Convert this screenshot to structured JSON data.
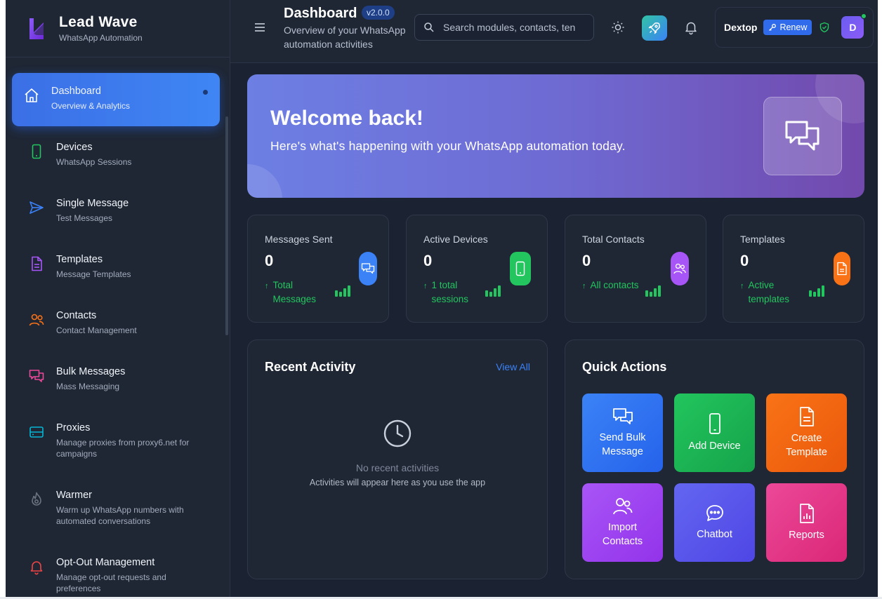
{
  "app": {
    "name": "Lead Wave",
    "subtitle": "WhatsApp Automation"
  },
  "sidebar": {
    "items": [
      {
        "label": "Dashboard",
        "sub": "Overview & Analytics",
        "icon": "home-icon",
        "active": true
      },
      {
        "label": "Devices",
        "sub": "WhatsApp Sessions",
        "icon": "phone-icon",
        "color": "#22c55e"
      },
      {
        "label": "Single Message",
        "sub": "Test Messages",
        "icon": "send-icon",
        "color": "#3b82f6"
      },
      {
        "label": "Templates",
        "sub": "Message Templates",
        "icon": "document-icon",
        "color": "#a855f7"
      },
      {
        "label": "Contacts",
        "sub": "Contact Management",
        "icon": "users-icon",
        "color": "#f97316"
      },
      {
        "label": "Bulk Messages",
        "sub": "Mass Messaging",
        "icon": "chat-bubbles-icon",
        "color": "#ec4899"
      },
      {
        "label": "Proxies",
        "sub": "Manage proxies from proxy6.net for campaigns",
        "icon": "server-icon",
        "color": "#06b6d4"
      },
      {
        "label": "Warmer",
        "sub": "Warm up WhatsApp numbers with automated conversations",
        "icon": "flame-icon",
        "color": "#6b7280"
      },
      {
        "label": "Opt-Out Management",
        "sub": "Manage opt-out requests and preferences",
        "icon": "bell-icon",
        "color": "#ef4444"
      }
    ]
  },
  "header": {
    "title": "Dashboard",
    "version": "v2.0.0",
    "subtitle": "Overview of your WhatsApp automation activities",
    "search_placeholder": "Search modules, contacts, ten",
    "user_name": "Dextop",
    "renew_label": "Renew",
    "avatar_initial": "D"
  },
  "hero": {
    "title": "Welcome back!",
    "subtitle": "Here's what's happening with your WhatsApp automation today."
  },
  "stats": [
    {
      "title": "Messages Sent",
      "value": "0",
      "note": "Total Messages",
      "icon": "chat-bubbles-icon",
      "color": "#3b82f6"
    },
    {
      "title": "Active Devices",
      "value": "0",
      "note": "1 total sessions",
      "icon": "phone-icon",
      "color": "#22c55e"
    },
    {
      "title": "Total Contacts",
      "value": "0",
      "note": "All contacts",
      "icon": "users-icon",
      "color": "#a855f7"
    },
    {
      "title": "Templates",
      "value": "0",
      "note": "Active templates",
      "icon": "document-icon",
      "color": "#f97316"
    }
  ],
  "recent_activity": {
    "title": "Recent Activity",
    "view_all": "View All",
    "empty_title": "No recent activities",
    "empty_sub": "Activities will appear here as you use the app"
  },
  "quick_actions": {
    "title": "Quick Actions",
    "items": [
      {
        "label": "Send Bulk Message",
        "icon": "chat-bubbles-icon",
        "color": "#3b82f6"
      },
      {
        "label": "Add Device",
        "icon": "phone-icon",
        "color": "#22c55e"
      },
      {
        "label": "Create Template",
        "icon": "document-icon",
        "color": "#f97316"
      },
      {
        "label": "Import Contacts",
        "icon": "users-icon",
        "color": "#a855f7"
      },
      {
        "label": "Chatbot",
        "icon": "chat-dots-icon",
        "color": "#6366f1"
      },
      {
        "label": "Reports",
        "icon": "report-icon",
        "color": "#ec4899"
      }
    ]
  }
}
